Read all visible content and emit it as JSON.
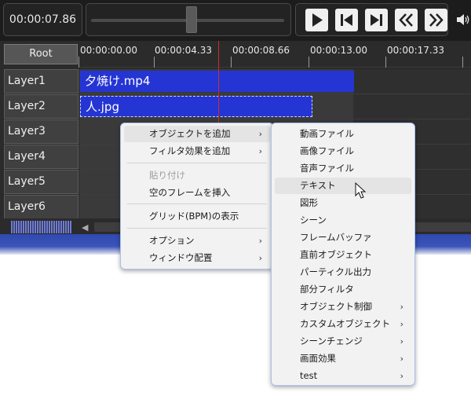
{
  "transport": {
    "time": "00:00:07.86",
    "buttons": [
      "play",
      "step-back",
      "step-forward",
      "rewind",
      "fast-forward"
    ]
  },
  "timeline": {
    "root_label": "Root",
    "ruler": [
      "00:00:00.00",
      "00:00:04.33",
      "00:00:08.66",
      "00:00:13.00",
      "00:00:17.33"
    ],
    "layers": [
      "Layer1",
      "Layer2",
      "Layer3",
      "Layer4",
      "Layer5",
      "Layer6"
    ],
    "clips": {
      "layer1": "夕焼け.mp4",
      "layer2": "人.jpg"
    }
  },
  "context_menu": {
    "items": [
      {
        "label": "オブジェクトを追加",
        "submenu": true
      },
      {
        "label": "フィルタ効果を追加",
        "submenu": true
      },
      {
        "label": "貼り付け",
        "disabled": true
      },
      {
        "label": "空のフレームを挿入"
      },
      {
        "label": "グリッド(BPM)の表示"
      },
      {
        "label": "オプション",
        "submenu": true
      },
      {
        "label": "ウィンドウ配置",
        "submenu": true
      }
    ]
  },
  "submenu": {
    "items": [
      {
        "label": "動画ファイル"
      },
      {
        "label": "画像ファイル"
      },
      {
        "label": "音声ファイル"
      },
      {
        "label": "テキスト",
        "highlighted": true
      },
      {
        "label": "図形"
      },
      {
        "label": "シーン"
      },
      {
        "label": "フレームバッファ"
      },
      {
        "label": "直前オブジェクト"
      },
      {
        "label": "パーティクル出力"
      },
      {
        "label": "部分フィルタ"
      },
      {
        "label": "オブジェクト制御",
        "submenu": true
      },
      {
        "label": "カスタムオブジェクト",
        "submenu": true
      },
      {
        "label": "シーンチェンジ",
        "submenu": true
      },
      {
        "label": "画面効果",
        "submenu": true
      },
      {
        "label": "test",
        "submenu": true
      }
    ]
  },
  "colors": {
    "clip": "#2535d4",
    "playhead": "#d02a2a",
    "menu_border": "#a8c2e8"
  }
}
